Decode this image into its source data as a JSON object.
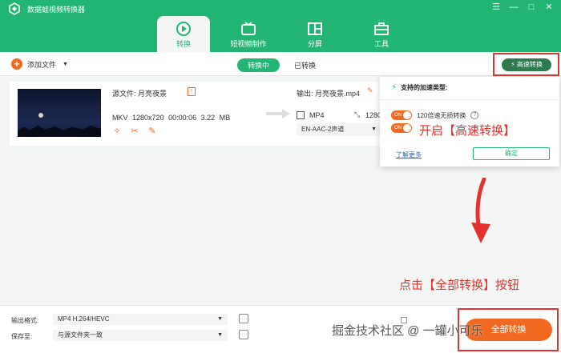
{
  "app": {
    "title": "数据蛙视频转换器",
    "window_buttons": [
      "☰",
      "—",
      "□",
      "✕"
    ]
  },
  "nav": [
    {
      "label": "转换",
      "icon": "convert-icon",
      "active": true
    },
    {
      "label": "短视频制作",
      "icon": "tv-icon",
      "active": false
    },
    {
      "label": "分屏",
      "icon": "split-screen-icon",
      "active": false
    },
    {
      "label": "工具",
      "icon": "toolbox-icon",
      "active": false
    }
  ],
  "toolbar": {
    "add_file": "添加文件",
    "tab_converting": "转换中",
    "tab_converted": "已转换",
    "fast_convert": "高速转换"
  },
  "file": {
    "source_label": "源文件:",
    "source_name": "月亮夜景",
    "format": "MKV",
    "resolution": "1280x720",
    "duration": "00:00:06",
    "size": "3.22 MB",
    "output_label": "输出:",
    "output_name": "月亮夜景.mp4",
    "output_format": "MP4",
    "output_resolution": "1280",
    "audio": "EN-AAC-2声道"
  },
  "popup": {
    "heading": "支持的加速类型:",
    "option1": "120倍速无损转换",
    "toggle_text": "ON",
    "learn_more": "了解更多",
    "ok": "确定"
  },
  "annotations": {
    "enable_fast": "开启【高速转换】",
    "click_convert_all": "点击【全部转换】按钮"
  },
  "bottom": {
    "output_format_label": "输出格式:",
    "output_format_value": "MP4 H.264/HEVC",
    "save_to_label": "保存至:",
    "save_to_value": "与源文件夹一致",
    "convert_all": "全部转换"
  },
  "watermark": "掘金技术社区 @ 一罐小可乐",
  "colors": {
    "brand": "#22b573",
    "accent": "#f26a21",
    "annotation": "#e3332f"
  }
}
